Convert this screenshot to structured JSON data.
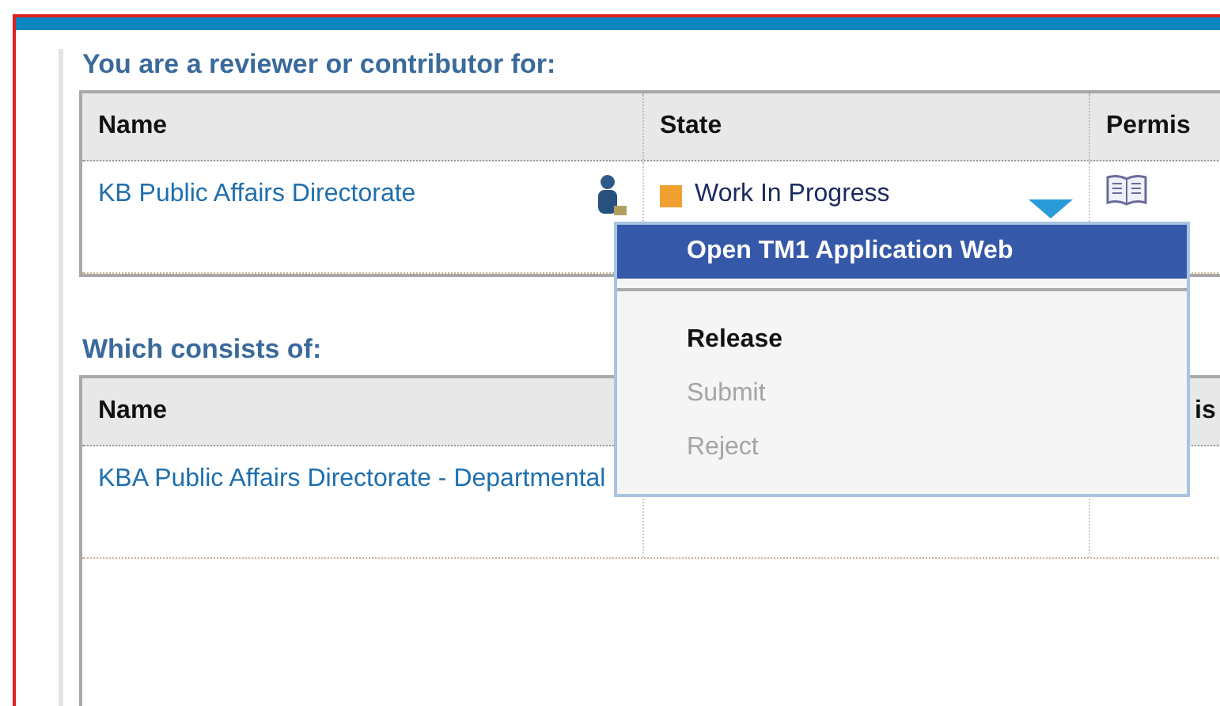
{
  "sections": [
    {
      "heading": "You are a reviewer or contributor for:",
      "name_header": "Name",
      "state_header": "State",
      "column_3_header": "Permis",
      "rows": [
        {
          "name": "KB Public Affairs Directorate",
          "state": "Work In Progress",
          "color": "#f0a030"
        }
      ]
    },
    {
      "heading": "Which consists of:",
      "name_header": "Name",
      "column_3_header": "is",
      "rows": [
        {
          "name": "KBA Public Affairs Directorate - Departmental"
        }
      ]
    }
  ],
  "menu": [
    {
      "kind": "action",
      "label": "Open TM1 Application Web",
      "selected": true,
      "disabled": false
    },
    {
      "kind": "separator"
    },
    {
      "kind": "action",
      "label": "Release",
      "selected": false,
      "disabled": false
    },
    {
      "kind": "action",
      "label": "Submit",
      "selected": false,
      "disabled": true
    },
    {
      "kind": "action",
      "label": "Reject",
      "selected": false,
      "disabled": true
    }
  ]
}
